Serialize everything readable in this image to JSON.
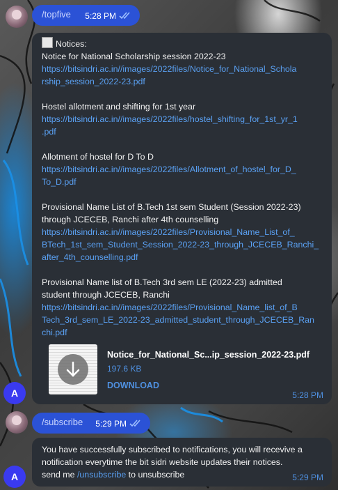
{
  "messages": {
    "topfive": {
      "command": "/topfive",
      "time": "5:28 PM"
    },
    "notices": {
      "header": "Notices:",
      "items": [
        {
          "title_lines": [
            "Notice for National Scholarship session 2022-23"
          ],
          "link_lines": [
            "https://bitsindri.ac.in//images/2022files/Notice_for_National_Schola",
            "rship_session_2022-23.pdf"
          ]
        },
        {
          "title_lines": [
            "Hostel allotment and shifting for 1st year"
          ],
          "link_lines": [
            "https://bitsindri.ac.in//images/2022files/hostel_shifting_for_1st_yr_1",
            ".pdf"
          ]
        },
        {
          "title_lines": [
            "Allotment of hostel for D To D"
          ],
          "link_lines": [
            "https://bitsindri.ac.in//images/2022files/Allotment_of_hostel_for_D_",
            "To_D.pdf"
          ]
        },
        {
          "title_lines": [
            "Provisional Name List of B.Tech 1st sem Student (Session 2022-23)",
            "through JCECEB, Ranchi after 4th counselling"
          ],
          "link_lines": [
            "https://bitsindri.ac.in//images/2022files/Provisional_Name_List_of_",
            "BTech_1st_sem_Student_Session_2022-23_through_JCECEB_Ranchi_",
            "after_4th_counselling.pdf"
          ]
        },
        {
          "title_lines": [
            "Provisional Name list of B.Tech 3rd sem LE (2022-23) admitted",
            "student through JCECEB, Ranchi"
          ],
          "link_lines": [
            "https://bitsindri.ac.in//images/2022files/Provisional_Name_list_of_B",
            "Tech_3rd_sem_LE_2022-23_admitted_student_through_JCECEB_Ran",
            "chi.pdf"
          ]
        }
      ],
      "file": {
        "name": "Notice_for_National_Sc...ip_session_2022-23.pdf",
        "size": "197.6 KB",
        "action": "DOWNLOAD"
      },
      "time": "5:28 PM",
      "avatar_letter": "A"
    },
    "subscribe": {
      "command": "/subscribe",
      "time": "5:29 PM"
    },
    "confirmation": {
      "line1": "You have successfully subscribed to notifications, you will recevive a",
      "line2": "notification everytime the bit sidri website updates their notices.",
      "line3_prefix": "send me ",
      "line3_link": "/unsubscribe",
      "line3_suffix": " to unsubscribe",
      "time": "5:29 PM",
      "avatar_letter": "A"
    }
  },
  "colors": {
    "outgoing_bubble": "#2b52d6",
    "incoming_bubble": "#2a2f36",
    "link": "#5aa0f2",
    "accent": "#4f90e0",
    "bot_avatar": "#3a3af0"
  },
  "icons": {
    "notice": "memo-icon",
    "read": "double-check-icon",
    "download": "arrow-down-icon"
  }
}
